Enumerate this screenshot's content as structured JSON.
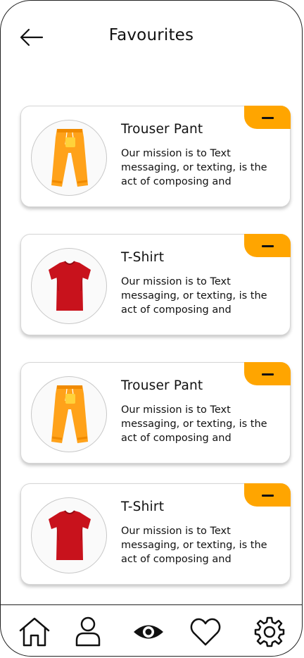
{
  "header": {
    "title": "Favourites",
    "back_icon": "arrow-left-icon"
  },
  "favourites": [
    {
      "name": "Trouser Pant",
      "description": "Our mission is to Text messaging, or texting, is the act of composing and",
      "image": "orange-trouser-pant",
      "remove_icon": "minus-icon"
    },
    {
      "name": "T-Shirt",
      "description": "Our mission is to Text messaging, or texting, is the act of composing and",
      "image": "red-t-shirt",
      "remove_icon": "minus-icon"
    },
    {
      "name": "Trouser Pant",
      "description": "Our mission is to Text messaging, or texting, is the act of composing and",
      "image": "orange-trouser-pant",
      "remove_icon": "minus-icon"
    },
    {
      "name": "T-Shirt",
      "description": "Our mission is to Text messaging, or texting, is the act of composing and",
      "image": "red-t-shirt",
      "remove_icon": "minus-icon"
    }
  ],
  "bottom_nav": [
    {
      "icon": "home-icon"
    },
    {
      "icon": "profile-icon"
    },
    {
      "icon": "eye-icon"
    },
    {
      "icon": "heart-icon"
    },
    {
      "icon": "settings-gear-icon"
    }
  ],
  "colors": {
    "accent": "#ffa500",
    "trouser": "#ffa21a",
    "tshirt": "#c8121c",
    "border": "#222222"
  }
}
